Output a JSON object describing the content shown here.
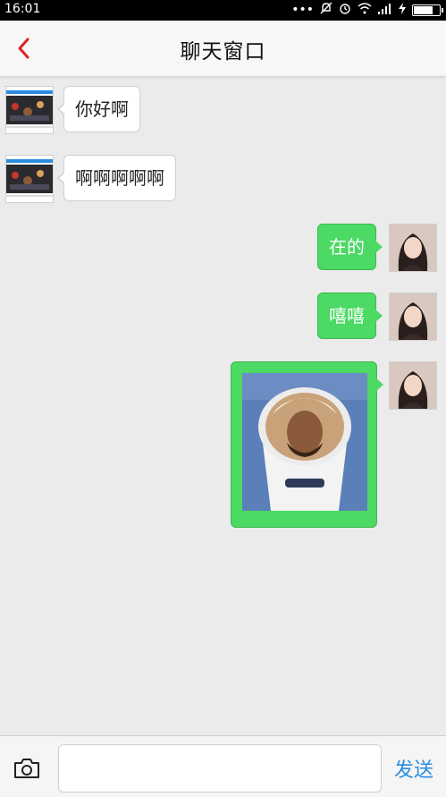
{
  "status_bar": {
    "time": "16:01",
    "icons": [
      "more-dots-icon",
      "mute-icon",
      "alarm-icon",
      "wifi-icon",
      "signal-icon",
      "charging-icon",
      "battery-icon"
    ]
  },
  "header": {
    "title": "聊天窗口",
    "back_icon": "chevron-left-icon",
    "accent_color": "#e02020"
  },
  "messages": [
    {
      "side": "left",
      "type": "text",
      "text": "你好啊",
      "avatar": "screenshot-thumbnail"
    },
    {
      "side": "left",
      "type": "text",
      "text": "啊啊啊啊啊",
      "avatar": "screenshot-thumbnail"
    },
    {
      "side": "right",
      "type": "text",
      "text": "在的",
      "avatar": "girl-photo"
    },
    {
      "side": "right",
      "type": "text",
      "text": "嘻嘻",
      "avatar": "girl-photo"
    },
    {
      "side": "right",
      "type": "image",
      "image": "coffee-cup-portrait-photo",
      "avatar": "girl-photo"
    }
  ],
  "colors": {
    "sent_bubble": "#4cd964",
    "received_bubble": "#ffffff",
    "background": "#ebebeb",
    "send_button": "#2a8de0"
  },
  "input_bar": {
    "camera_icon": "camera-icon",
    "input_value": "",
    "input_placeholder": "",
    "send_label": "发送"
  }
}
